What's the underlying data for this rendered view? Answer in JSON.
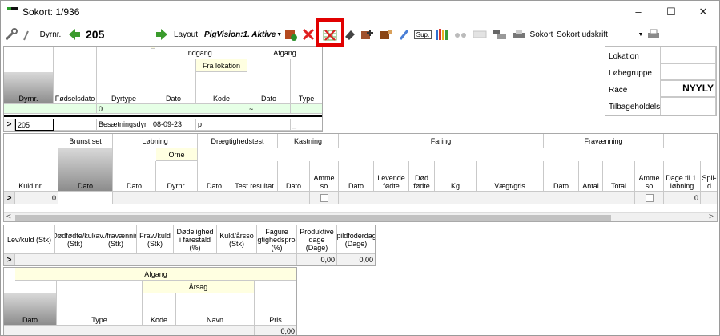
{
  "window": {
    "title": "Sokort: 1/936"
  },
  "toolbar": {
    "animal_label": "Dyrnr.",
    "animal_number": "205",
    "layout_label": "Layout",
    "layout_value": "PigVision:1. Aktive",
    "sup_label": "Sup.",
    "sokort_label": "Sokort",
    "sokort_select": "Sokort udskrift"
  },
  "top_grid": {
    "group_indgang": "Indgang",
    "group_afgang": "Afgang",
    "sub_fra_lokation": "Fra lokation",
    "headers": [
      "Dyrnr.",
      "Fødselsdato",
      "Dyrtype",
      "Dato",
      "Kode",
      "Dato",
      "Type"
    ],
    "filter_count": "0",
    "filter_tilde": "~",
    "row": {
      "dyrnr": "205",
      "dyrtype": "Besætningsdyr",
      "dato": "08-09-23",
      "kode": "p",
      "type": "_"
    }
  },
  "side_panel": {
    "lokation_label": "Lokation",
    "lobegruppe_label": "Løbegruppe",
    "race_label": "Race",
    "race_value": "NYYLY",
    "tilbageholdels_label": "Tilbageholdels"
  },
  "litter_grid": {
    "group_brunst": "Brunst set",
    "group_lobning": "Løbning",
    "sub_orne": "Orne",
    "group_draegtighed": "Drægtighedstest",
    "group_kastning": "Kastning",
    "group_faring": "Faring",
    "group_fravaenning": "Fravænning",
    "headers": [
      "Kuld nr.",
      "Dato",
      "Dato",
      "Dyrnr.",
      "Dato",
      "Test resultat",
      "Dato",
      "Amme so",
      "Dato",
      "Levende fødte",
      "Død fødte",
      "Kg",
      "Vægt/gris",
      "Dato",
      "Antal",
      "Total",
      "Amme so",
      "Dage til 1. løbning",
      "Spil-d"
    ],
    "row_kuld": "0",
    "row_dage": "0"
  },
  "stats_grid": {
    "headers": [
      "Lev/kuld (Stk)",
      "Dødfødte/kuld (Stk)",
      "Frav./fravænning (Stk)",
      "Frav./kuld (Stk)",
      "Dødelighed i farestald (%)",
      "Kuld/årsso (Stk)",
      "Fagure drægtighedsprocent (%)",
      "Produktive dage (Dage)",
      "Spildfoderdage (Dage)"
    ],
    "values": [
      "",
      "",
      "",
      "",
      "",
      "",
      "",
      "0,00",
      "0,00"
    ]
  },
  "afgang_grid": {
    "group_afgang": "Afgang",
    "sub_arsag": "Årsag",
    "headers": [
      "Dato",
      "Type",
      "Kode",
      "Navn",
      "Pris"
    ],
    "pris_value": "0,00"
  },
  "colors": {
    "highlight": "#e10000",
    "yellow_header": "#ffffe1",
    "green_filter": "#e6ffe6"
  }
}
